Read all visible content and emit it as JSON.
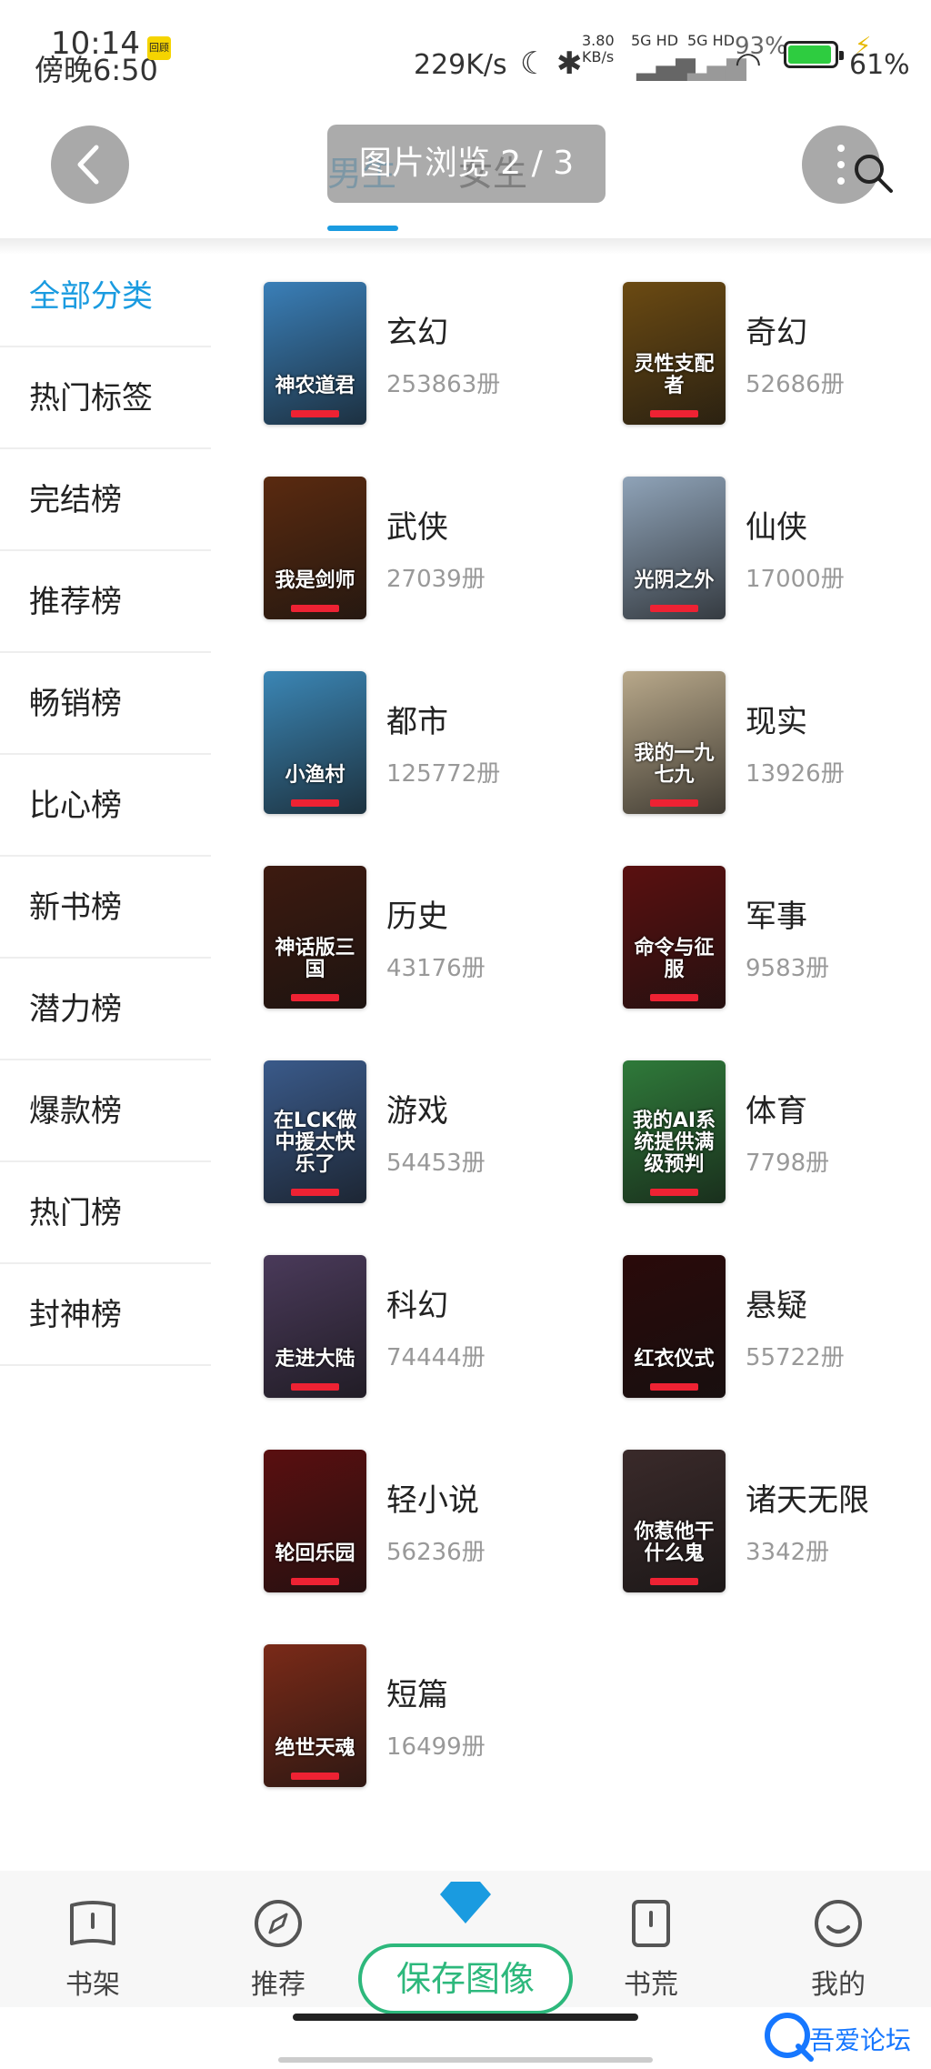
{
  "status_bar": {
    "time_a": "10:14",
    "time_b": "傍晚6:50",
    "badge": "回顾",
    "net_speed": "229K/s",
    "net_small_value": "3.80",
    "net_small_unit": "KB/s",
    "signal_a": "5G HD",
    "signal_b": "5G HD",
    "battery_a": "93%",
    "battery_b": "61%",
    "battery_level": 0.93
  },
  "header": {
    "tabs": [
      "男生",
      "女生"
    ],
    "active_tab": 0,
    "overlay_text": "图片浏览 2 / 3"
  },
  "sidebar": {
    "items": [
      "全部分类",
      "热门标签",
      "完结榜",
      "推荐榜",
      "畅销榜",
      "比心榜",
      "新书榜",
      "潜力榜",
      "爆款榜",
      "热门榜",
      "封神榜"
    ],
    "active_index": 0
  },
  "categories": [
    {
      "name": "玄幻",
      "count": "253863册",
      "cover_title": "神农道君",
      "cover_color": "#3a7fb8"
    },
    {
      "name": "奇幻",
      "count": "52686册",
      "cover_title": "灵性支配者",
      "cover_color": "#6b4a12"
    },
    {
      "name": "武侠",
      "count": "27039册",
      "cover_title": "我是剑师",
      "cover_color": "#5a2a10"
    },
    {
      "name": "仙侠",
      "count": "17000册",
      "cover_title": "光阴之外",
      "cover_color": "#8fa3b8"
    },
    {
      "name": "都市",
      "count": "125772册",
      "cover_title": "小渔村",
      "cover_color": "#3b86b5"
    },
    {
      "name": "现实",
      "count": "13926册",
      "cover_title": "我的一九七九",
      "cover_color": "#b8a88a"
    },
    {
      "name": "历史",
      "count": "43176册",
      "cover_title": "神话版三国",
      "cover_color": "#3d1a10"
    },
    {
      "name": "军事",
      "count": "9583册",
      "cover_title": "命令与征服",
      "cover_color": "#5a1010"
    },
    {
      "name": "游戏",
      "count": "54453册",
      "cover_title": "在LCK做中援太快乐了",
      "cover_color": "#3a5a8a"
    },
    {
      "name": "体育",
      "count": "7798册",
      "cover_title": "我的AI系统提供满级预判",
      "cover_color": "#2f7a3a"
    },
    {
      "name": "科幻",
      "count": "74444册",
      "cover_title": "走进大陆",
      "cover_color": "#4a3a5a"
    },
    {
      "name": "悬疑",
      "count": "55722册",
      "cover_title": "红衣仪式",
      "cover_color": "#2a0a0a"
    },
    {
      "name": "轻小说",
      "count": "56236册",
      "cover_title": "轮回乐园",
      "cover_color": "#5a0f10"
    },
    {
      "name": "诸天无限",
      "count": "3342册",
      "cover_title": "你惹他干什么鬼",
      "cover_color": "#3a2a2a"
    },
    {
      "name": "短篇",
      "count": "16499册",
      "cover_title": "绝世天魂",
      "cover_color": "#7a2a18"
    }
  ],
  "bottom_nav": {
    "items": [
      {
        "label": "书架",
        "icon": "book-icon"
      },
      {
        "label": "推荐",
        "icon": "compass-icon"
      },
      {
        "label": "",
        "icon": "diamond-icon"
      },
      {
        "label": "书荒",
        "icon": "book-alert-icon"
      },
      {
        "label": "我的",
        "icon": "smile-icon"
      }
    ],
    "active_index": 2
  },
  "save_button": "保存图像",
  "watermark": "吾爱论坛",
  "colors": {
    "accent": "#1a9be0",
    "save_green": "#2db87c",
    "count_gray": "#999999"
  }
}
